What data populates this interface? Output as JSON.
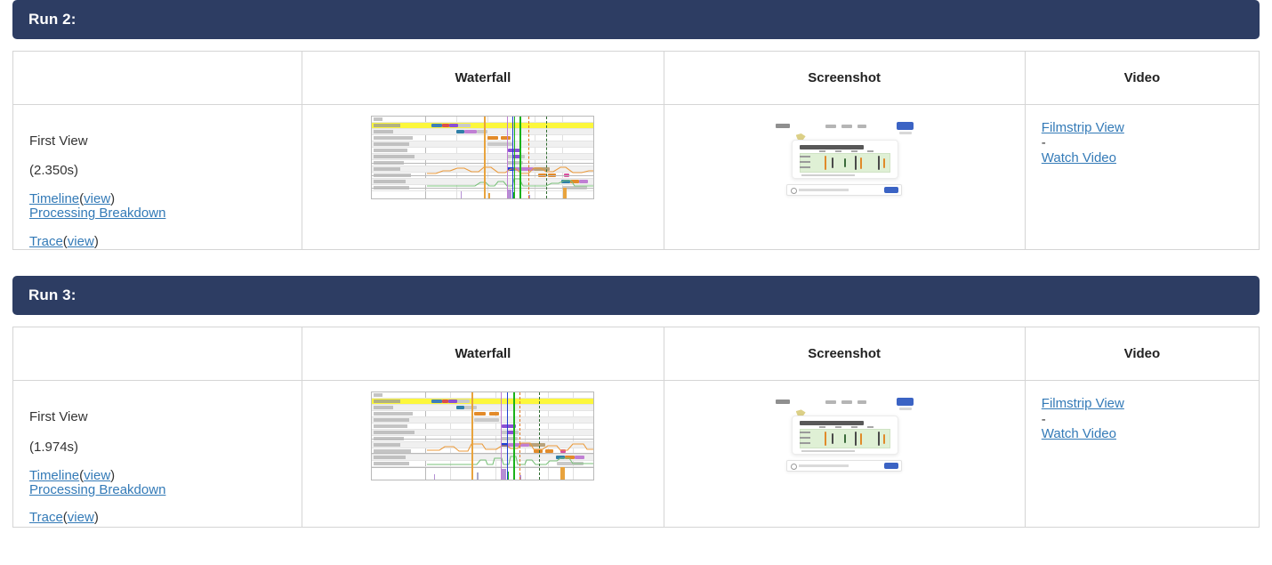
{
  "page": {
    "accent_header_bg": "#2d3d63",
    "link_color": "#337ab7",
    "border_color": "#d5d5d5"
  },
  "runs": [
    {
      "header_label": "Run 2:",
      "columns": {
        "info": "",
        "waterfall": "Waterfall",
        "screenshot": "Screenshot",
        "video": "Video"
      },
      "info": {
        "view_label": "First View",
        "duration": "(2.350s)",
        "timeline_link": "Timeline",
        "timeline_view_link": "view",
        "processing_breakdown_link": "Processing Breakdown",
        "trace_link": "Trace",
        "trace_view_link": "view",
        "open_paren": "(",
        "close_paren": ")"
      },
      "video": {
        "filmstrip_link": "Filmstrip View",
        "separator": "-",
        "watch_link": "Watch Video"
      },
      "waterfall_thumb": {
        "icon": "waterfall-chart-thumbnail",
        "highlight_row_color": "#fcf73c",
        "bar_colors": [
          "#3f7fb8",
          "#d94f4f",
          "#8a4fd4",
          "#c0c0c0",
          "#e38b2a",
          "#7ac17a",
          "#b9a27a"
        ],
        "marker_colors": [
          "#e8a33d",
          "#c07fd4",
          "#1f3fd4",
          "#19b219",
          "#2f6b2f",
          "#e07820"
        ]
      },
      "screenshot_thumb": {
        "icon": "page-screenshot-thumbnail",
        "cta_color": "#3b63c4",
        "table_tint": "#dff0d5"
      }
    },
    {
      "header_label": "Run 3:",
      "columns": {
        "info": "",
        "waterfall": "Waterfall",
        "screenshot": "Screenshot",
        "video": "Video"
      },
      "info": {
        "view_label": "First View",
        "duration": "(1.974s)",
        "timeline_link": "Timeline",
        "timeline_view_link": "view",
        "processing_breakdown_link": "Processing Breakdown",
        "trace_link": "Trace",
        "trace_view_link": "view",
        "open_paren": "(",
        "close_paren": ")"
      },
      "video": {
        "filmstrip_link": "Filmstrip View",
        "separator": "-",
        "watch_link": "Watch Video"
      },
      "waterfall_thumb": {
        "icon": "waterfall-chart-thumbnail",
        "highlight_row_color": "#fcf73c",
        "bar_colors": [
          "#3f7fb8",
          "#d94f4f",
          "#8a4fd4",
          "#c0c0c0",
          "#e38b2a",
          "#7ac17a",
          "#b9a27a"
        ],
        "marker_colors": [
          "#e8a33d",
          "#c07fd4",
          "#1f3fd4",
          "#19b219",
          "#2f6b2f",
          "#e07820"
        ]
      },
      "screenshot_thumb": {
        "icon": "page-screenshot-thumbnail",
        "cta_color": "#3b63c4",
        "table_tint": "#dff0d5"
      }
    }
  ]
}
